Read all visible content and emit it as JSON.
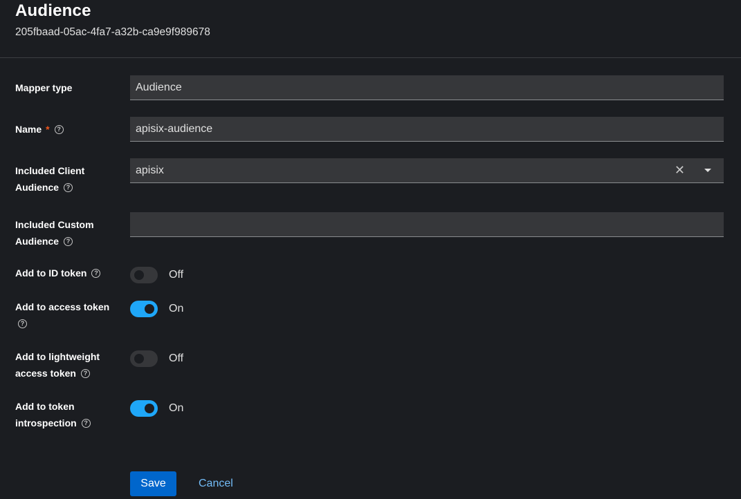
{
  "header": {
    "title": "Audience",
    "subtitle": "205fbaad-05ac-4fa7-a32b-ca9e9f989678"
  },
  "form": {
    "mapper_type": {
      "label": "Mapper type",
      "value": "Audience"
    },
    "name": {
      "label": "Name",
      "required": "*",
      "value": "apisix-audience"
    },
    "included_client_audience": {
      "label_line1": "Included Client",
      "label_line2": "Audience",
      "value": "apisix"
    },
    "included_custom_audience": {
      "label_line1": "Included Custom",
      "label_line2": "Audience",
      "value": ""
    },
    "add_to_id_token": {
      "label": "Add to ID token",
      "state": "Off"
    },
    "add_to_access_token": {
      "label": "Add to access token",
      "state": "On"
    },
    "add_to_lightweight_access_token": {
      "label_line1": "Add to lightweight",
      "label_line2": "access token",
      "state": "Off"
    },
    "add_to_token_introspection": {
      "label_line1": "Add to token",
      "label_line2": "introspection",
      "state": "On"
    }
  },
  "icons": {
    "help": "?",
    "clear": "✕"
  },
  "actions": {
    "save_label": "Save",
    "cancel_label": "Cancel"
  },
  "colors": {
    "background": "#1b1d21",
    "field_bg": "#36373a",
    "switch_on": "#1fa7f8",
    "primary_button": "#0066cc",
    "link": "#73bcf7",
    "required": "#f0561d"
  }
}
